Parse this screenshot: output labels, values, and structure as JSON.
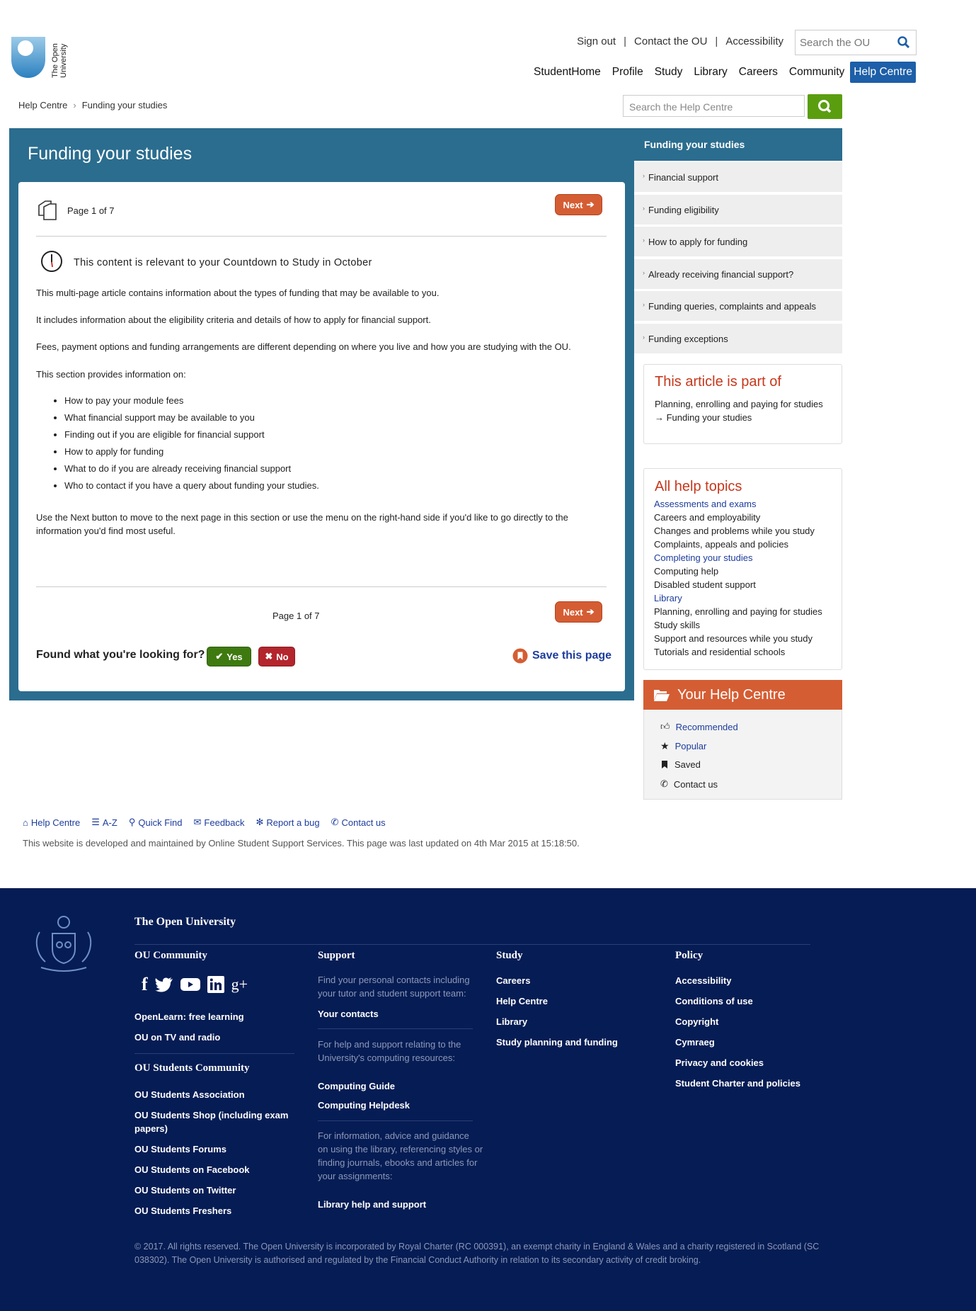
{
  "header": {
    "logo_text_line1": "The Open",
    "logo_text_line2": "University",
    "top_links": [
      "Sign out",
      "Contact the OU",
      "Accessibility"
    ],
    "search_placeholder": "Search the OU",
    "nav": [
      "StudentHome",
      "Profile",
      "Study",
      "Library",
      "Careers",
      "Community"
    ],
    "nav_active": "Help Centre"
  },
  "breadcrumb": {
    "home": "Help Centre",
    "current": "Funding your studies"
  },
  "hc_search_placeholder": "Search the Help Centre",
  "main": {
    "title": "Funding your studies",
    "page_indicator": "Page 1 of 7",
    "next_label": "Next",
    "countdown": "This content is relevant to your Countdown to Study in October",
    "paragraphs": [
      "This multi-page article contains information about the types of funding that may be available to you.",
      "It includes information about the eligibility criteria and details of how to apply for financial support.",
      "Fees, payment options and funding arrangements are different depending on where you live and how you are studying with the OU.",
      "This section provides information on:"
    ],
    "bullets": [
      "How to pay your module fees",
      "What financial support may be available to you",
      "Finding out if you are eligible for financial support",
      "How to apply for funding",
      "What to do if you are already receiving financial support",
      "Who to contact if you have a query about funding your studies."
    ],
    "closing_line1": "Use the Next button to move to the next page in this section or use the menu on the right-hand side if you'd like to go directly to the",
    "closing_line2": "information you'd find most useful.",
    "found_question": "Found what you're looking for?",
    "yes_label": "Yes",
    "no_label": "No",
    "save_label": "Save this page"
  },
  "sidebar": {
    "heading": "Funding your studies",
    "items": [
      "Financial support",
      "Funding eligibility",
      "How to apply for funding",
      "Already receiving financial support?",
      "Funding queries, complaints and appeals",
      "Funding exceptions"
    ],
    "article_part_title": "This article is part of",
    "article_part_line1": "Planning, enrolling and paying for studies",
    "article_part_line2": "→ Funding your studies",
    "topics_title": "All help topics",
    "topics": [
      "Assessments and exams",
      "Careers and employability",
      "Changes and problems while you study",
      "Complaints, appeals and policies",
      "Completing your studies",
      "Computing help",
      "Disabled student support",
      "Library",
      "Planning, enrolling and paying for studies",
      "Study skills",
      "Support and resources while you study",
      "Tutorials and residential schools"
    ],
    "your_help_title": "Your Help Centre",
    "your_help_items": [
      "Recommended",
      "Popular",
      "Saved",
      "Contact us"
    ]
  },
  "footer_links": [
    "Help Centre",
    "A-Z",
    "Quick Find",
    "Feedback",
    "Report a bug",
    "Contact us"
  ],
  "footer_note": "This website is developed and maintained by Online Student Support Services. This page was last updated on 4th Mar 2015 at 15:18:50.",
  "footer": {
    "org": "The Open University",
    "community_title": "OU Community",
    "community_links": [
      "OpenLearn: free learning",
      "OU on TV and radio"
    ],
    "students_title": "OU Students Community",
    "students_links": [
      "OU Students Association",
      "OU Students Shop (including exam",
      "papers)",
      "OU Students Forums",
      "OU Students on Facebook",
      "OU Students on Twitter",
      "OU Students Freshers"
    ],
    "support_title": "Support",
    "support_text1_l1": "Find your personal contacts including",
    "support_text1_l2": "your tutor and student support team:",
    "support_link1": "Your contacts",
    "support_text2_l1": "For help and support relating to the",
    "support_text2_l2": "University's computing resources:",
    "support_link2": "Computing Guide",
    "support_link3": "Computing Helpdesk",
    "support_text3_l1": "For information, advice and guidance",
    "support_text3_l2": "on using the library, referencing styles or",
    "support_text3_l3": "finding journals, ebooks and articles for",
    "support_text3_l4": "your assignments:",
    "support_link4": "Library help and support",
    "study_title": "Study",
    "study_links": [
      "Careers",
      "Help Centre",
      "Library",
      "Study planning and funding"
    ],
    "policy_title": "Policy",
    "policy_links": [
      "Accessibility",
      "Conditions of use",
      "Copyright",
      "Cymraeg",
      "Privacy and cookies",
      "Student Charter and policies"
    ],
    "copyright_l1": "© 2017. All rights reserved. The Open University is incorporated by Royal Charter (RC 000391), an exempt charity in England & Wales and a charity registered in Scotland (SC",
    "copyright_l2": "038302). The Open University is authorised and regulated by the Financial Conduct Authority in relation to its secondary activity of credit broking."
  },
  "colors": {
    "brand_blue": "#2b6d8f",
    "accent_orange": "#d55d33",
    "footer_navy": "#061c54",
    "nav_active": "#1d5fa8"
  }
}
